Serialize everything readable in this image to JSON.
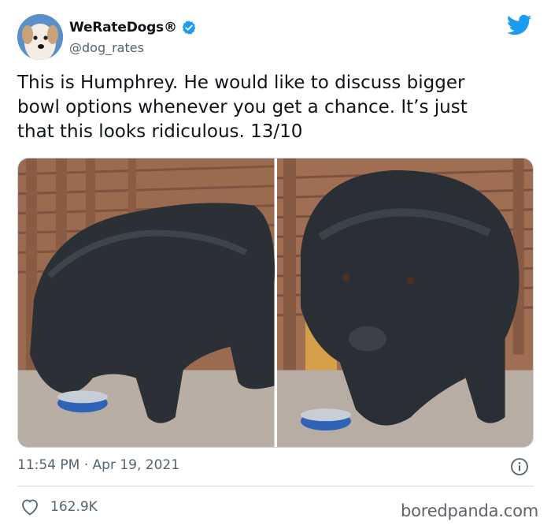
{
  "tweet": {
    "author": {
      "display_name": "WeRateDogs®",
      "handle": "@dog_rates",
      "verified": true
    },
    "text": "This is Humphrey. He would like to discuss bigger\nbowl options whenever you get a chance. It’s just\nthat this looks ridiculous. 13/10",
    "timestamp": "11:54 PM · Apr 19, 2021",
    "likes": "162.9K"
  },
  "icons": {
    "verified": "verified-badge-icon",
    "platform": "twitter-bird-icon",
    "info": "info-icon",
    "like": "heart-icon"
  },
  "watermark": "boredpanda.com",
  "colors": {
    "accent": "#1d9bf0",
    "text": "#0f1419",
    "secondary": "#536471"
  }
}
